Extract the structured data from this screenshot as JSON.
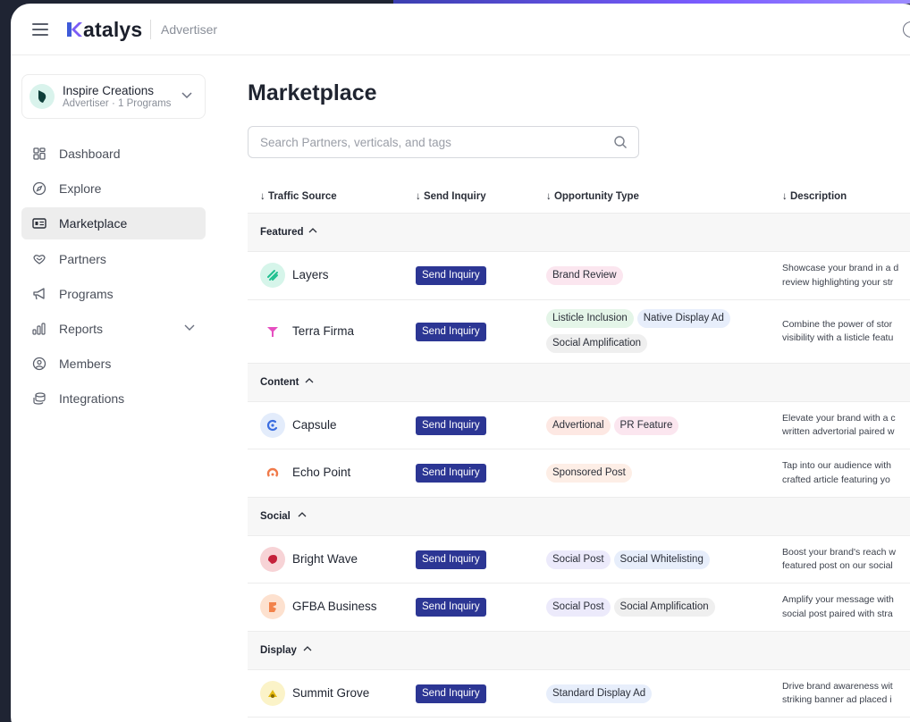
{
  "app": {
    "brand": "atalys",
    "brand_initial": "K",
    "role": "Advertiser"
  },
  "org": {
    "name": "Inspire Creations",
    "subtitle": "Advertiser · 1 Programs"
  },
  "nav": [
    {
      "label": "Dashboard",
      "icon": "grid-icon"
    },
    {
      "label": "Explore",
      "icon": "compass-icon"
    },
    {
      "label": "Marketplace",
      "icon": "id-card-icon",
      "active": true
    },
    {
      "label": "Partners",
      "icon": "handshake-icon"
    },
    {
      "label": "Programs",
      "icon": "megaphone-icon"
    },
    {
      "label": "Reports",
      "icon": "bar-chart-icon",
      "expandable": true
    },
    {
      "label": "Members",
      "icon": "user-circle-icon"
    },
    {
      "label": "Integrations",
      "icon": "database-icon"
    }
  ],
  "main": {
    "title": "Marketplace",
    "search_placeholder": "Search Partners, verticals, and tags",
    "columns": [
      "↓ Traffic Source",
      "↓ Send Inquiry",
      "↓ Opportunity Type",
      "↓ Description"
    ],
    "button_label": "Send Inquiry"
  },
  "groups": [
    {
      "label": "Featured",
      "rows": [
        {
          "name": "Layers",
          "tags": [
            "Brand Review"
          ],
          "desc": [
            "Showcase your brand in a d",
            "review highlighting your str"
          ]
        },
        {
          "name": "Terra Firma",
          "tags": [
            "Listicle Inclusion",
            "Native Display Ad",
            "Social Amplification"
          ],
          "desc": [
            "Combine the power of stor",
            "visibility with a listicle featu"
          ]
        }
      ]
    },
    {
      "label": "Content",
      "rows": [
        {
          "name": "Capsule",
          "tags": [
            "Advertional",
            "PR Feature"
          ],
          "desc": [
            "Elevate your brand with a c",
            "written advertorial paired w"
          ]
        },
        {
          "name": "Echo Point",
          "tags": [
            "Sponsored Post"
          ],
          "desc": [
            "Tap into our audience with",
            "crafted article featuring yo"
          ]
        }
      ]
    },
    {
      "label": "Social",
      "rows": [
        {
          "name": "Bright Wave",
          "tags": [
            "Social Post",
            "Social Whitelisting"
          ],
          "desc": [
            "Boost your brand's reach w",
            "featured post on our social"
          ]
        },
        {
          "name": "GFBA Business",
          "tags": [
            "Social Post",
            "Social Amplification"
          ],
          "desc": [
            "Amplify your message with",
            "social post paired with stra"
          ]
        }
      ]
    },
    {
      "label": "Display",
      "rows": [
        {
          "name": "Summit Grove",
          "tags": [
            "Standard Display Ad"
          ],
          "desc": [
            "Drive brand awareness wit",
            "striking banner ad placed i"
          ]
        }
      ]
    }
  ],
  "colors": {
    "button": "#2c3694",
    "tag_pink": "#fbe6ef",
    "tag_green": "#e4f5e8",
    "tag_blue": "#e7eefb",
    "tag_grey": "#efefef",
    "tag_peach": "#fde8e3",
    "tag_lavender": "#eceafb"
  }
}
